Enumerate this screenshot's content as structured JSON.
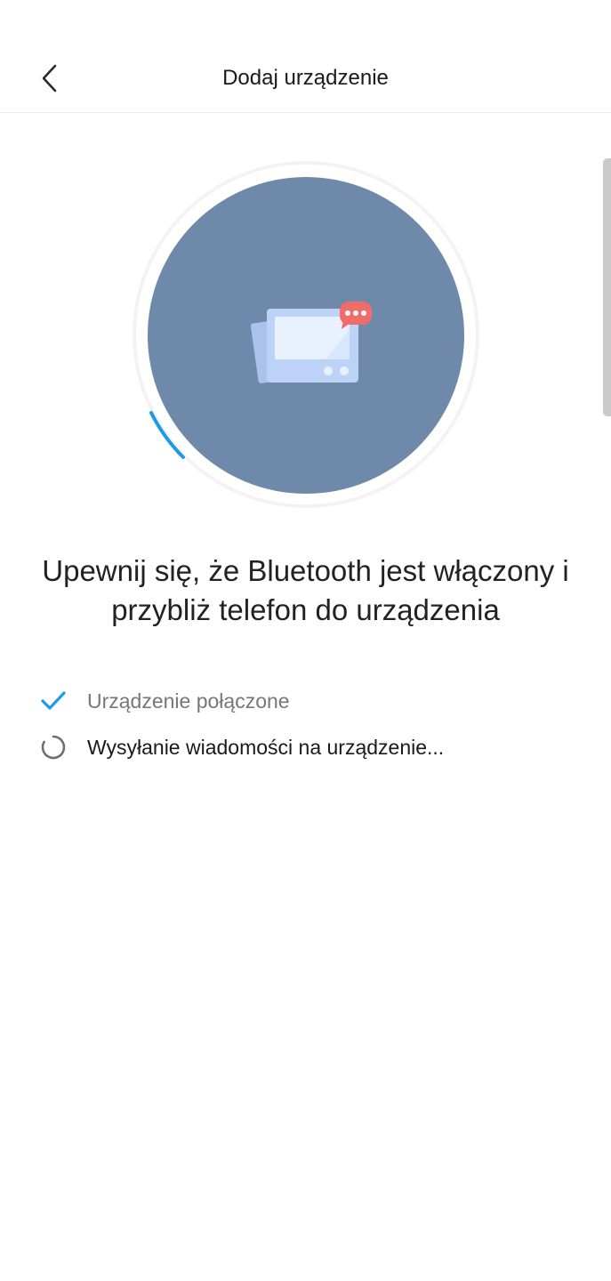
{
  "header": {
    "title": "Dodaj urządzenie",
    "back_icon": "chevron-left-icon"
  },
  "illustration": {
    "circle_color": "#6f89ab",
    "progress_color": "#1e9be8",
    "device_icon": "device-tablet-icon",
    "badge_icon": "message-dots-icon",
    "badge_color": "#f26b6b"
  },
  "main": {
    "heading_line1": "Upewnij się, że Bluetooth jest włączony i",
    "heading_line2": "przybliż telefon do urządzenia"
  },
  "status": {
    "items": [
      {
        "label": "Urządzenie połączone",
        "state": "done",
        "icon": "checkmark-icon"
      },
      {
        "label": "Wysyłanie wiadomości na urządzenie...",
        "state": "in-progress",
        "icon": "loading-spinner-icon"
      }
    ]
  },
  "colors": {
    "accent": "#1e9be8",
    "text_primary": "#1a1a1a",
    "text_secondary": "#777777"
  }
}
